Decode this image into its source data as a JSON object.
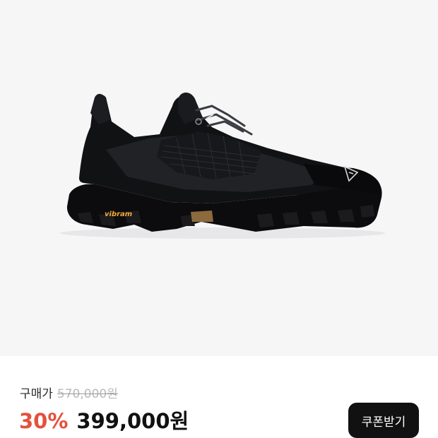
{
  "product": {
    "image_name": "black-hiking-shoe-image",
    "sole_brand_text": "vibram",
    "colors": {
      "image_background": "#f6f6f7",
      "shoe": "#111214",
      "sole_logo": "#f2a93b"
    }
  },
  "price": {
    "original_label": "구매가",
    "original_price": "570,000원",
    "discount_rate": "30%",
    "sale_price": "399,000원"
  },
  "actions": {
    "coupon_label": "쿠폰받기"
  },
  "colors": {
    "discount_accent": "#e4513c",
    "button_background": "#111111",
    "button_text": "#ffffff",
    "strikethrough_text": "#b9b9b9"
  }
}
